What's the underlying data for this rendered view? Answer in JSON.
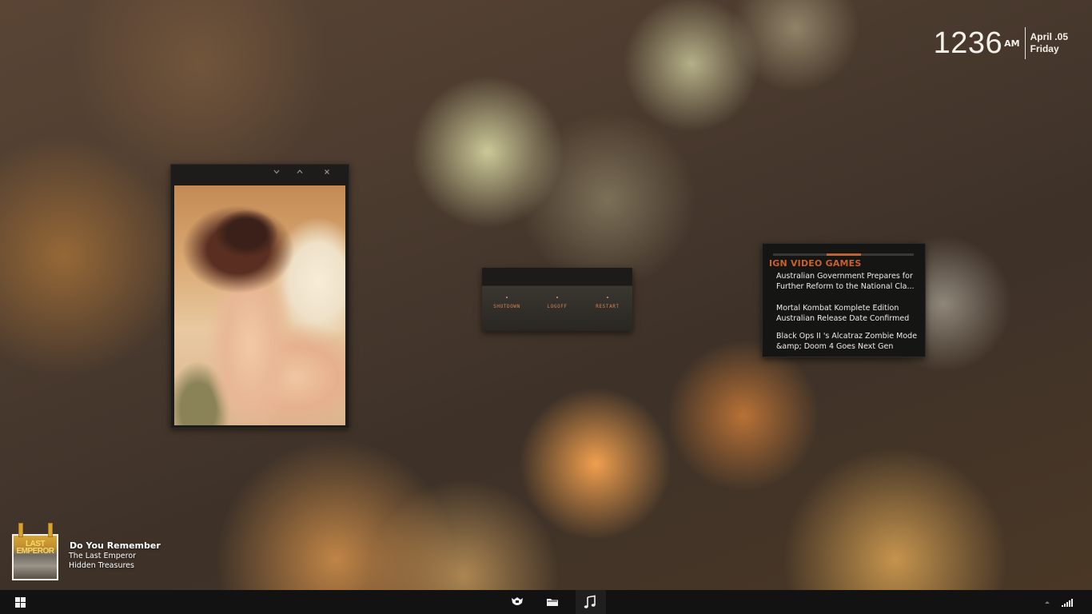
{
  "clock": {
    "time": "1236",
    "ampm": "AM",
    "date_line1": "April .05",
    "date_line2": "Friday"
  },
  "photo_widget": {
    "controls": [
      "chevron-down-icon",
      "chevron-up-icon",
      "close-icon"
    ]
  },
  "power": {
    "buttons": [
      {
        "label": "SHUTDOWN"
      },
      {
        "label": "LOGOFF"
      },
      {
        "label": "RESTART"
      }
    ]
  },
  "rss": {
    "title": "IGN VIDEO GAMES",
    "items": [
      {
        "line1": "Australian Government Prepares for",
        "line2": "Further Reform to the National Cla..."
      },
      {
        "line1": "Mortal Kombat Komplete Edition",
        "line2": "Australian Release Date Confirmed"
      },
      {
        "line1": "Black Ops II 's Alcatraz Zombie Mode",
        "line2": "&amp; Doom 4 Goes Next Gen"
      }
    ],
    "accent_color": "#c5602e"
  },
  "now_playing": {
    "track": "Do You Remember",
    "artist": "The Last Emperor",
    "album": "Hidden Treasures",
    "album_art_text_line1": "LAST",
    "album_art_text_line2": "EMPEROR"
  },
  "taskbar": {
    "start_icon": "windows-start-icon",
    "apps": [
      "shield-app-icon",
      "folder-icon",
      "music-note-icon"
    ],
    "tray": [
      "tray-up-arrow-icon",
      "signal-bars-icon"
    ]
  }
}
